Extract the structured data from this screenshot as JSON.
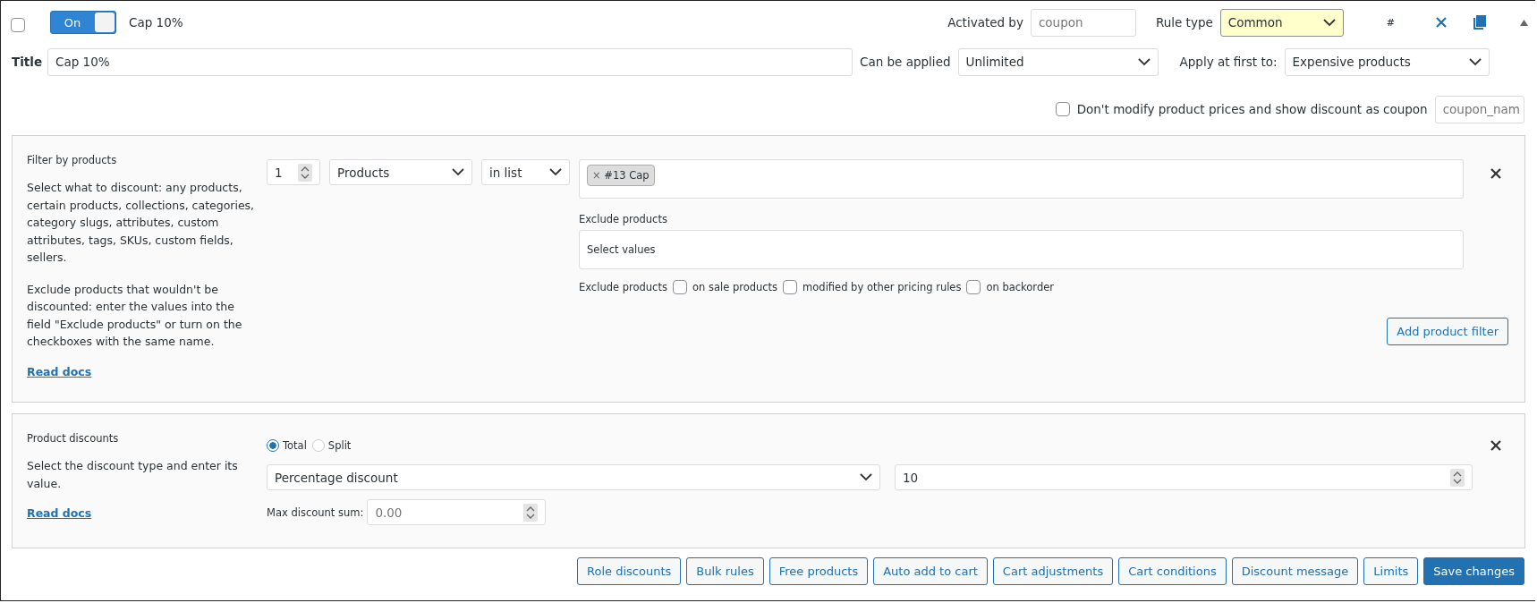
{
  "rule": {
    "selected": false,
    "enabled": true,
    "toggle_label": "On",
    "name": "Cap 10%",
    "activated_by": {
      "label": "Activated by",
      "placeholder": "coupon"
    },
    "rule_type": {
      "label": "Rule type",
      "value": "Common"
    },
    "hash": "#",
    "title": {
      "label": "Title",
      "value": "Cap 10%"
    },
    "can_be_applied": {
      "label": "Can be applied",
      "value": "Unlimited"
    },
    "apply_first": {
      "label": "Apply at first to:",
      "value": "Expensive products"
    },
    "coupon_option": {
      "checked": false,
      "label": "Don't modify product prices and show discount as coupon",
      "placeholder": "coupon_nam"
    }
  },
  "filter_panel": {
    "heading": "Filter by products",
    "paragraphs": [
      "Select what to discount: any products, certain products, collections, categories, category slugs, attributes, custom attributes, tags, SKUs, custom fields, sellers.",
      "Exclude products that wouldn't be discounted: enter the values into the field \"Exclude products\" or turn on the checkboxes with the same name."
    ],
    "link": "Read docs",
    "qty": "1",
    "type": "Products",
    "method": "in list",
    "tag_remove": "×",
    "tags": [
      "#13 Cap"
    ],
    "exclude_label": "Exclude products",
    "exclude_placeholder": "Select values",
    "exclude_checks_label": "Exclude products",
    "exclude_checks": [
      {
        "label": "on sale products",
        "checked": false
      },
      {
        "label": "modified by other pricing rules",
        "checked": false
      },
      {
        "label": "on backorder",
        "checked": false
      }
    ],
    "add_button": "Add product filter"
  },
  "discount_panel": {
    "heading": "Product discounts",
    "paragraph": "Select the discount type and enter its value.",
    "link": "Read docs",
    "radios": [
      {
        "label": "Total",
        "selected": true
      },
      {
        "label": "Split",
        "selected": false
      }
    ],
    "type": "Percentage discount",
    "value": "10",
    "max_label": "Max discount sum:",
    "max_value": "0.00"
  },
  "buttons": [
    {
      "label": "Role discounts",
      "kind": "secondary"
    },
    {
      "label": "Bulk rules",
      "kind": "secondary"
    },
    {
      "label": "Free products",
      "kind": "secondary"
    },
    {
      "label": "Auto add to cart",
      "kind": "secondary"
    },
    {
      "label": "Cart adjustments",
      "kind": "secondary"
    },
    {
      "label": "Cart conditions",
      "kind": "secondary"
    },
    {
      "label": "Discount message",
      "kind": "secondary"
    },
    {
      "label": "Limits",
      "kind": "secondary"
    },
    {
      "label": "Save changes",
      "kind": "primary"
    }
  ]
}
